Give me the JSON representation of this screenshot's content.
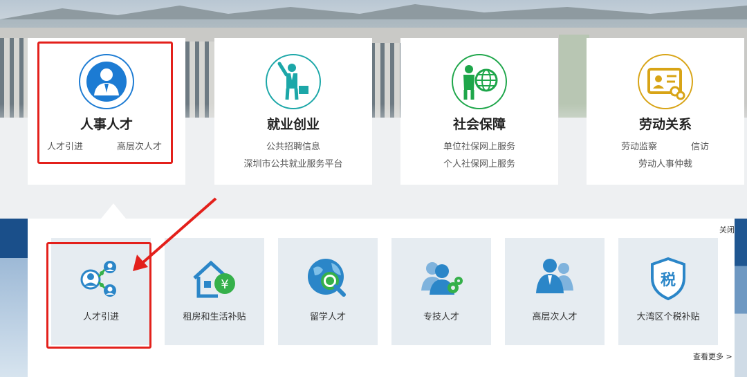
{
  "cards": [
    {
      "title": "人事人才",
      "icon": "person-suit-icon",
      "color": "#1c7bd3",
      "links": [
        "人才引进",
        "高层次人才"
      ]
    },
    {
      "title": "就业创业",
      "icon": "worker-briefcase-icon",
      "color": "#1ca7a8",
      "links": [
        "公共招聘信息",
        "深圳市公共就业服务平台"
      ]
    },
    {
      "title": "社会保障",
      "icon": "person-globe-icon",
      "color": "#1ea64a",
      "links": [
        "单位社保网上服务",
        "个人社保网上服务"
      ]
    },
    {
      "title": "劳动关系",
      "icon": "id-card-icon",
      "color": "#d8a416",
      "links": [
        "劳动监察",
        "信访",
        "劳动人事仲裁"
      ]
    }
  ],
  "panel": {
    "close_label": "关闭",
    "more_label": "查看更多 >",
    "tiles": [
      {
        "label": "人才引进",
        "icon": "talent-network-icon"
      },
      {
        "label": "租房和生活补贴",
        "icon": "house-subsidy-icon"
      },
      {
        "label": "留学人才",
        "icon": "globe-search-icon"
      },
      {
        "label": "专技人才",
        "icon": "people-gears-icon"
      },
      {
        "label": "高层次人才",
        "icon": "people-group-icon"
      },
      {
        "label": "大湾区个税补贴",
        "icon": "tax-shield-icon"
      }
    ]
  },
  "colors": {
    "accent_blue": "#1c7bd3",
    "highlight_red": "#e3201b",
    "tile_bg": "#e6ecf1"
  }
}
